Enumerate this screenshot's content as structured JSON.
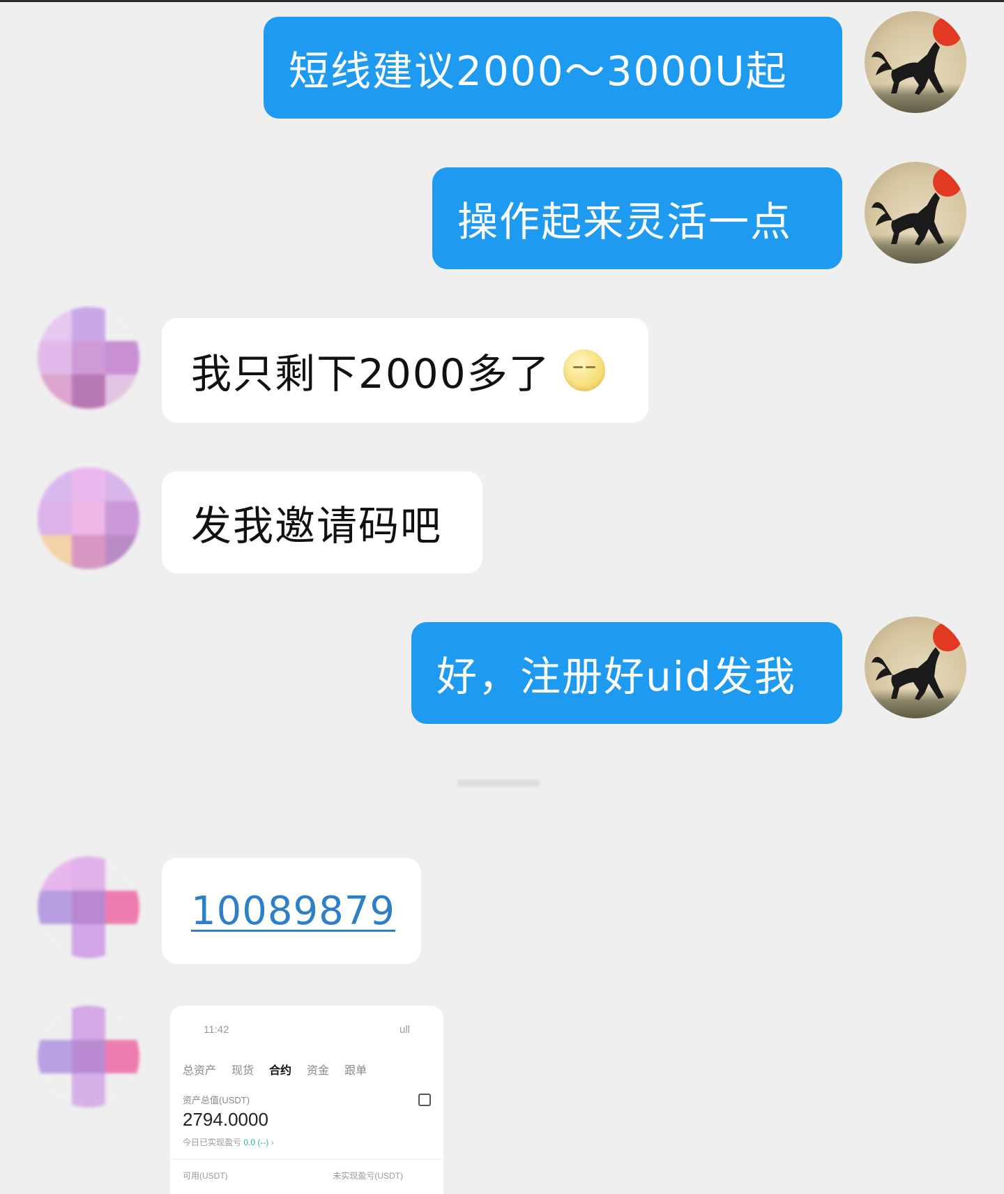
{
  "messages": [
    {
      "side": "right",
      "text": "短线建议2000～3000U起"
    },
    {
      "side": "right",
      "text": "操作起来灵活一点"
    },
    {
      "side": "left",
      "text": "我只剩下2000多了",
      "emoji": "sleepy-face"
    },
    {
      "side": "left",
      "text": "发我邀请码吧"
    },
    {
      "side": "right",
      "text": "好，注册好uid发我"
    },
    {
      "side": "left",
      "text": "10089879",
      "is_link": true
    },
    {
      "side": "left",
      "type": "image-screenshot"
    }
  ],
  "screenshot": {
    "time": "11:42",
    "signal": "ull",
    "tabs": [
      "总资产",
      "现货",
      "合约",
      "资金",
      "跟单"
    ],
    "active_tab": "合约",
    "asset_label": "资产总值(USDT)",
    "amount": "2794.0000",
    "pnl_label": "今日已实现盈亏",
    "pnl_value": "0.0 (--)",
    "bottom_left": "可用(USDT)",
    "bottom_right": "未实现盈亏(USDT)"
  },
  "colors": {
    "background": "#efefef",
    "bubble_blue": "#1e9bf0",
    "bubble_white": "#ffffff",
    "link": "#2f7fc8"
  }
}
